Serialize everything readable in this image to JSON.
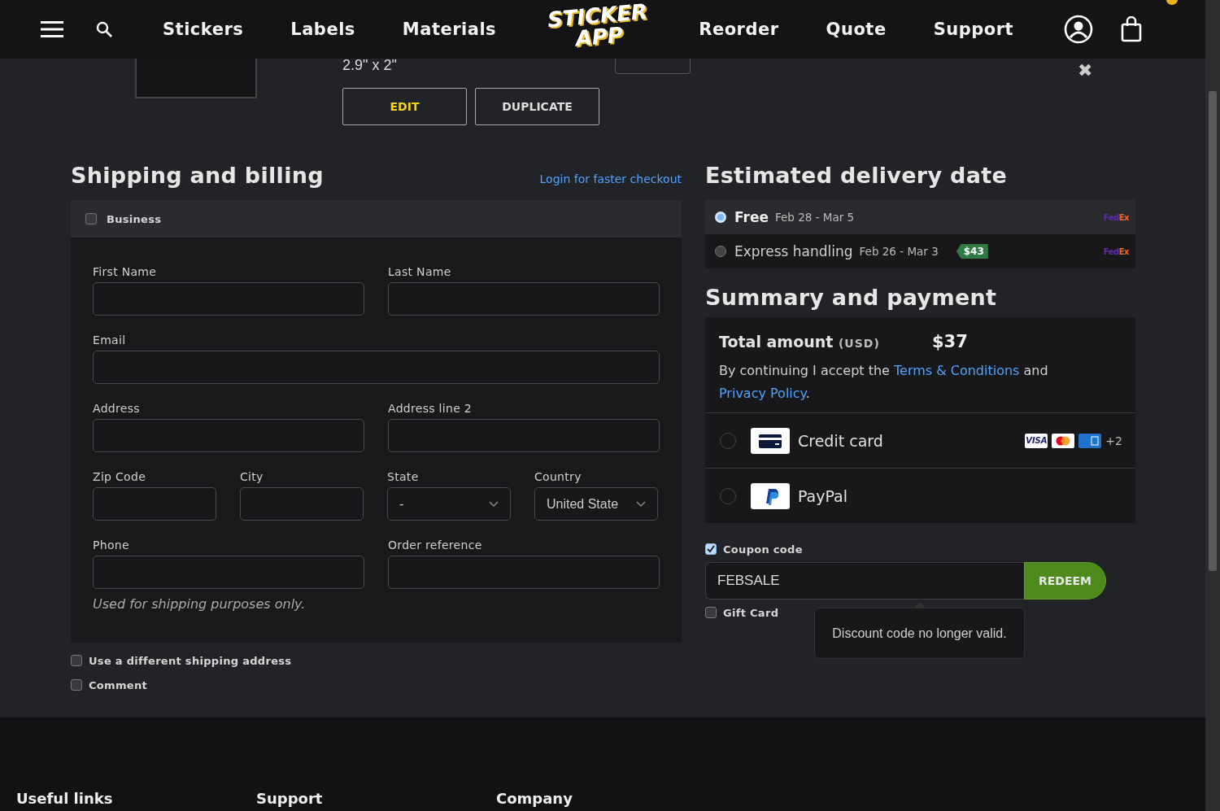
{
  "header": {
    "nav_left": [
      "Stickers",
      "Labels",
      "Materials"
    ],
    "logo": [
      "STICKER",
      "APP"
    ],
    "nav_right": [
      "Reorder",
      "Quote",
      "Support"
    ],
    "cart_badge": true
  },
  "product": {
    "size": "2.9\" x 2\"",
    "remove": "✖",
    "buttons": [
      {
        "label": "EDIT",
        "primary": true
      },
      {
        "label": "DUPLICATE",
        "primary": false
      }
    ]
  },
  "shipping": {
    "title": "Shipping and billing",
    "login_link": "Login for faster checkout",
    "business": {
      "label": "Business",
      "checked": false
    },
    "rows": [
      [
        {
          "label": "First Name",
          "kind": "text"
        },
        {
          "label": "Last Name",
          "kind": "text"
        }
      ],
      [
        {
          "label": "Email",
          "kind": "text"
        }
      ],
      [
        {
          "label": "Address",
          "kind": "text"
        },
        {
          "label": "Address line 2",
          "kind": "text"
        }
      ],
      [
        {
          "label": "Zip Code",
          "kind": "text"
        },
        {
          "label": "City",
          "kind": "text"
        },
        {
          "label": "State",
          "kind": "select",
          "value": "-"
        },
        {
          "label": "Country",
          "kind": "select",
          "value": "United State"
        }
      ],
      [
        {
          "label": "Phone",
          "kind": "text",
          "hint": "Used for shipping purposes only."
        },
        {
          "label": "Order reference",
          "kind": "text"
        }
      ]
    ],
    "options": [
      {
        "label": "Use a different shipping address",
        "checked": false
      },
      {
        "label": "Comment",
        "checked": false
      }
    ]
  },
  "delivery": {
    "title": "Estimated delivery date",
    "options": [
      {
        "name": "Free",
        "dates": "Feb 28 - Mar 5",
        "selected": true,
        "carrier": [
          "Fed",
          "Ex"
        ]
      },
      {
        "name": "Express handling",
        "dates": "Feb 26 - Mar 3",
        "price": "$43",
        "selected": false,
        "carrier": [
          "Fed",
          "Ex"
        ]
      }
    ]
  },
  "summary": {
    "title": "Summary and payment",
    "total_label": "Total amount",
    "currency": "(USD)",
    "total": "$37",
    "terms": [
      {
        "kind": "text",
        "text": "By continuing I accept the "
      },
      {
        "kind": "link",
        "text": "Terms & Conditions"
      },
      {
        "kind": "text",
        "text": " and "
      },
      {
        "kind": "link",
        "text": "Privacy Policy"
      },
      {
        "kind": "text",
        "text": "."
      }
    ],
    "methods": [
      {
        "kind": "card",
        "name": "Credit card",
        "selected": false,
        "brands": [
          {
            "kind": "visa",
            "label": "VISA"
          },
          {
            "kind": "mastercard"
          },
          {
            "kind": "amex"
          }
        ],
        "more": "+2"
      },
      {
        "kind": "paypal",
        "name": "PayPal",
        "selected": false
      }
    ]
  },
  "coupon": {
    "label": "Coupon code",
    "checked": true,
    "value": "FEBSALE",
    "button": "REDEEM",
    "gift": {
      "label": "Gift Card",
      "checked": false
    },
    "message": "Discount code no longer valid."
  },
  "footer": {
    "headings": [
      "Useful links",
      "Support",
      "Company"
    ]
  }
}
